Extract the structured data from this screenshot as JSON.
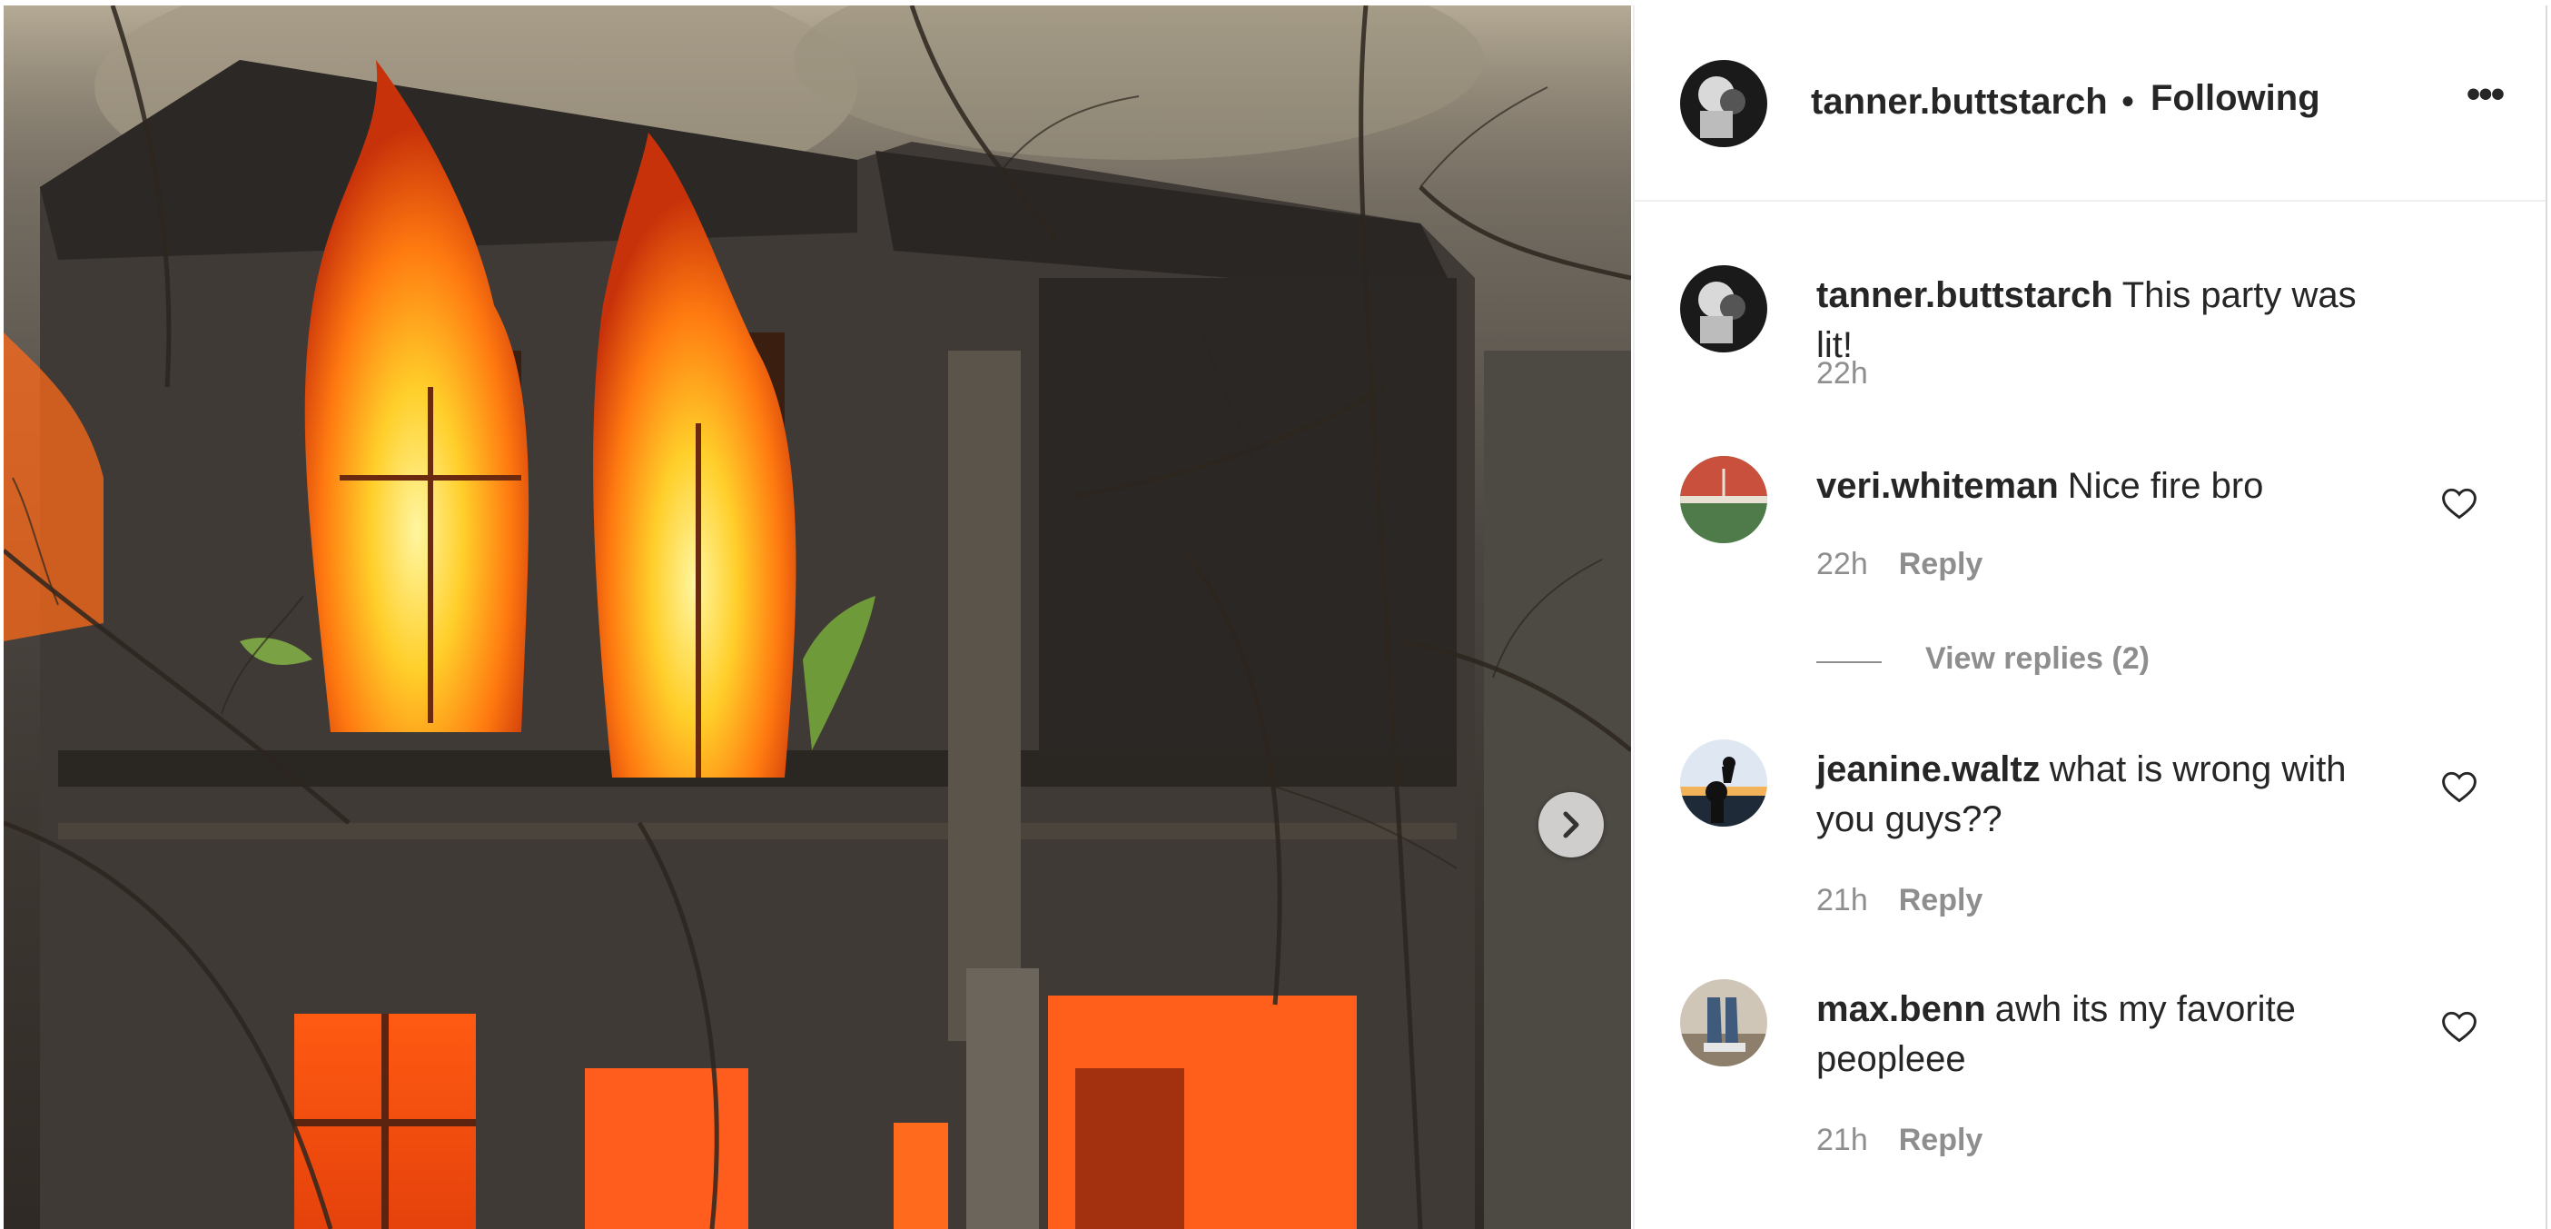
{
  "post": {
    "image_alt": "Burning building photo",
    "next_icon": "chevron-right-icon"
  },
  "header": {
    "username": "tanner.buttstarch",
    "separator": "•",
    "follow_label": "Following",
    "more_icon": "more-horizontal-icon",
    "more_label": "•••"
  },
  "comments": [
    {
      "username": "tanner.buttstarch",
      "text": "This party was lit!",
      "time": "22h",
      "is_caption": true
    },
    {
      "username": "veri.whiteman",
      "text": "Nice fire bro",
      "time": "22h",
      "reply_label": "Reply",
      "view_replies": "View replies (2)"
    },
    {
      "username": "jeanine.waltz",
      "text": "what is wrong with you guys??",
      "time": "21h",
      "reply_label": "Reply"
    },
    {
      "username": "max.benn",
      "text": "awh its my favorite peopleee",
      "time": "21h",
      "reply_label": "Reply"
    }
  ],
  "colors": {
    "text": "#262626",
    "secondary": "#8e8e8e",
    "divider": "#efefef"
  }
}
